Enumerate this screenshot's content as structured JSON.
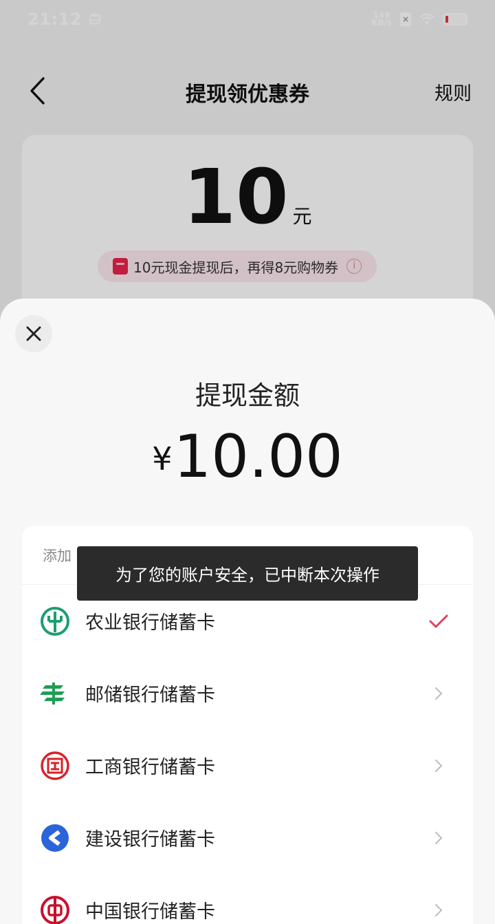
{
  "status_bar": {
    "time": "21:12",
    "net_speed_value": "148",
    "net_speed_unit": "KB/s",
    "icons": [
      "database-icon",
      "sim-icon",
      "wifi-icon",
      "battery-icon"
    ]
  },
  "nav": {
    "title": "提现领优惠券",
    "rules_label": "规则",
    "back_icon": "chevron-left-icon"
  },
  "reward": {
    "amount": "10",
    "unit": "元",
    "promo_text": "10元现金提现后，再得8元购物券",
    "promo_icon": "red-envelope-icon",
    "info_icon": "info-icon"
  },
  "sheet": {
    "close_icon": "close-icon",
    "title": "提现金额",
    "currency": "¥",
    "amount": "10.00",
    "add_card_label": "添加",
    "banks": [
      {
        "label": "农业银行储蓄卡",
        "icon": "abc-bank-logo-icon",
        "color": "#1e9e6e",
        "selected": true
      },
      {
        "label": "邮储银行储蓄卡",
        "icon": "psbc-bank-logo-icon",
        "color": "#1e9e55",
        "selected": false
      },
      {
        "label": "工商银行储蓄卡",
        "icon": "icbc-bank-logo-icon",
        "color": "#d6222a",
        "selected": false
      },
      {
        "label": "建设银行储蓄卡",
        "icon": "ccb-bank-logo-icon",
        "color": "#2a64d8",
        "selected": false
      },
      {
        "label": "中国银行储蓄卡",
        "icon": "boc-bank-logo-icon",
        "color": "#c8102e",
        "selected": false
      }
    ]
  },
  "toast": {
    "message": "为了您的账户安全，已中断本次操作"
  },
  "colors": {
    "accent": "#e8234c",
    "check": "#e0405e",
    "toast_bg": "#2b2b2b"
  }
}
